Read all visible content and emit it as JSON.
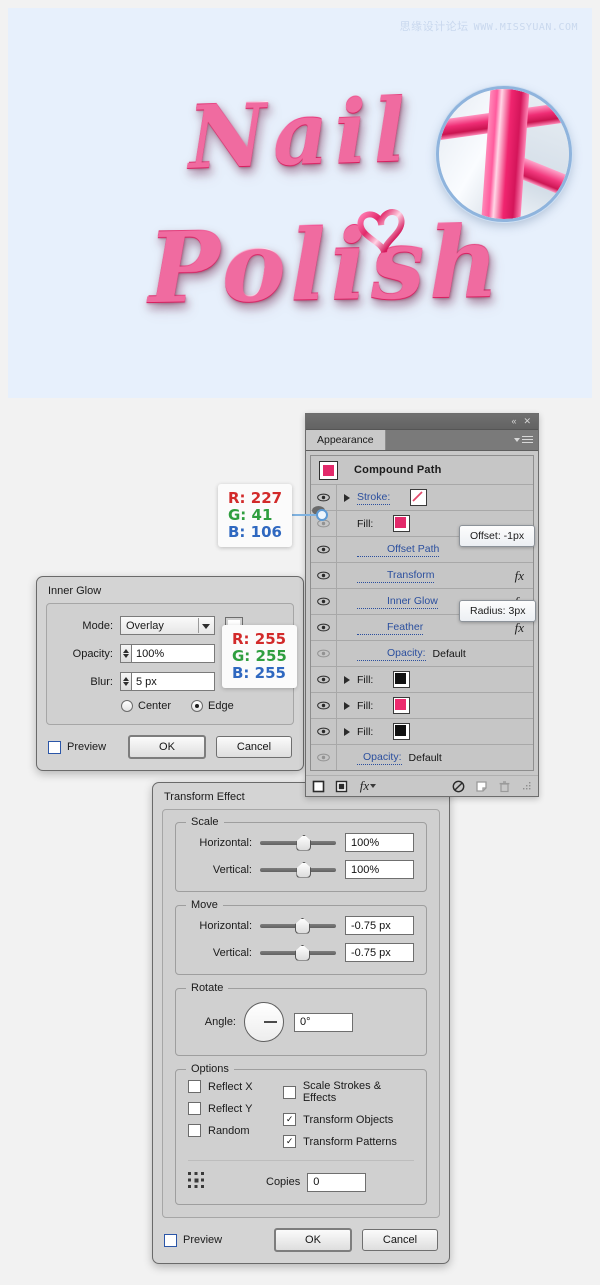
{
  "artwork": {
    "watermark_cn": "思缘设计论坛",
    "watermark_url": "WWW.MISSYUAN.COM",
    "word_line1": "Nail",
    "word_line2": "Polish",
    "accent_color": "#e2296a",
    "background_color": "#e7f0fc",
    "magnifier_name": "zoom-detail-circle"
  },
  "panel": {
    "tab_label": "Appearance",
    "object_title": "Compound Path",
    "object_swatch_color": "#e2296a",
    "collapse_icon": "«",
    "close_icon": "✕",
    "rows": [
      {
        "label": "Stroke:",
        "kind": "link",
        "swatch": "none",
        "has_arrow": true,
        "eye": "visible",
        "fx": false
      },
      {
        "label": "Fill:",
        "kind": "plain",
        "swatch": "#e2296a",
        "has_arrow": false,
        "eye": "dim",
        "fx": false
      },
      {
        "label": "Offset Path",
        "kind": "link",
        "swatch": null,
        "has_arrow": false,
        "eye": "visible",
        "fx": false
      },
      {
        "label": "Transform",
        "kind": "link",
        "swatch": null,
        "has_arrow": false,
        "eye": "visible",
        "fx": true
      },
      {
        "label": "Inner Glow",
        "kind": "link",
        "swatch": null,
        "has_arrow": false,
        "eye": "visible",
        "fx": true
      },
      {
        "label": "Feather",
        "kind": "link",
        "swatch": null,
        "has_arrow": false,
        "eye": "visible",
        "fx": true
      },
      {
        "label": "Opacity:",
        "value": "Default",
        "kind": "link-value",
        "swatch": null,
        "has_arrow": false,
        "eye": "dim",
        "fx": false
      },
      {
        "label": "Fill:",
        "kind": "plain",
        "swatch": "#111111",
        "has_arrow": true,
        "eye": "visible",
        "fx": false
      },
      {
        "label": "Fill:",
        "kind": "plain",
        "swatch": "#ec2a6e",
        "has_arrow": true,
        "eye": "visible",
        "fx": false
      },
      {
        "label": "Fill:",
        "kind": "plain",
        "swatch": "#111111",
        "has_arrow": true,
        "eye": "visible",
        "fx": false
      },
      {
        "label": "Opacity:",
        "value": "Default",
        "kind": "link-value",
        "swatch": null,
        "has_arrow": false,
        "eye": "dim",
        "fx": false
      }
    ],
    "footer_icons": [
      "add-new-stroke-icon",
      "add-new-fill-icon",
      "add-new-effect-icon",
      "clear-appearance-icon",
      "duplicate-item-icon",
      "delete-item-icon",
      "resize-grip-icon"
    ]
  },
  "tooltips": {
    "offset": "Offset: -1px",
    "radius": "Radius: 3px"
  },
  "callouts": {
    "fill_color": {
      "r": "R: 227",
      "g": "G: 41",
      "b": "B: 106"
    },
    "glow_color": {
      "r": "R: 255",
      "g": "G: 255",
      "b": "B: 255"
    }
  },
  "inner_glow": {
    "title": "Inner Glow",
    "mode_label": "Mode:",
    "mode_value": "Overlay",
    "opacity_label": "Opacity:",
    "opacity_value": "100%",
    "blur_label": "Blur:",
    "blur_value": "5 px",
    "radio_center": "Center",
    "radio_edge": "Edge",
    "selected_radio": "Edge",
    "preview_label": "Preview",
    "preview_checked": false,
    "ok_label": "OK",
    "cancel_label": "Cancel",
    "color_chip": "#ffffff"
  },
  "transform_effect": {
    "title": "Transform Effect",
    "scale_group": "Scale",
    "scale_horizontal_label": "Horizontal:",
    "scale_horizontal_value": "100%",
    "scale_vertical_label": "Vertical:",
    "scale_vertical_value": "100%",
    "move_group": "Move",
    "move_horizontal_label": "Horizontal:",
    "move_horizontal_value": "-0.75 px",
    "move_vertical_label": "Vertical:",
    "move_vertical_value": "-0.75 px",
    "rotate_group": "Rotate",
    "angle_label": "Angle:",
    "angle_value": "0°",
    "options_group": "Options",
    "reflect_x": "Reflect X",
    "reflect_y": "Reflect Y",
    "random": "Random",
    "scale_strokes": "Scale Strokes & Effects",
    "transform_objects": "Transform Objects",
    "transform_patterns": "Transform Patterns",
    "reflect_x_checked": false,
    "reflect_y_checked": false,
    "random_checked": false,
    "scale_strokes_checked": false,
    "transform_objects_checked": true,
    "transform_patterns_checked": true,
    "copies_label": "Copies",
    "copies_value": "0",
    "preview_label": "Preview",
    "preview_checked": false,
    "ok_label": "OK",
    "cancel_label": "Cancel"
  }
}
